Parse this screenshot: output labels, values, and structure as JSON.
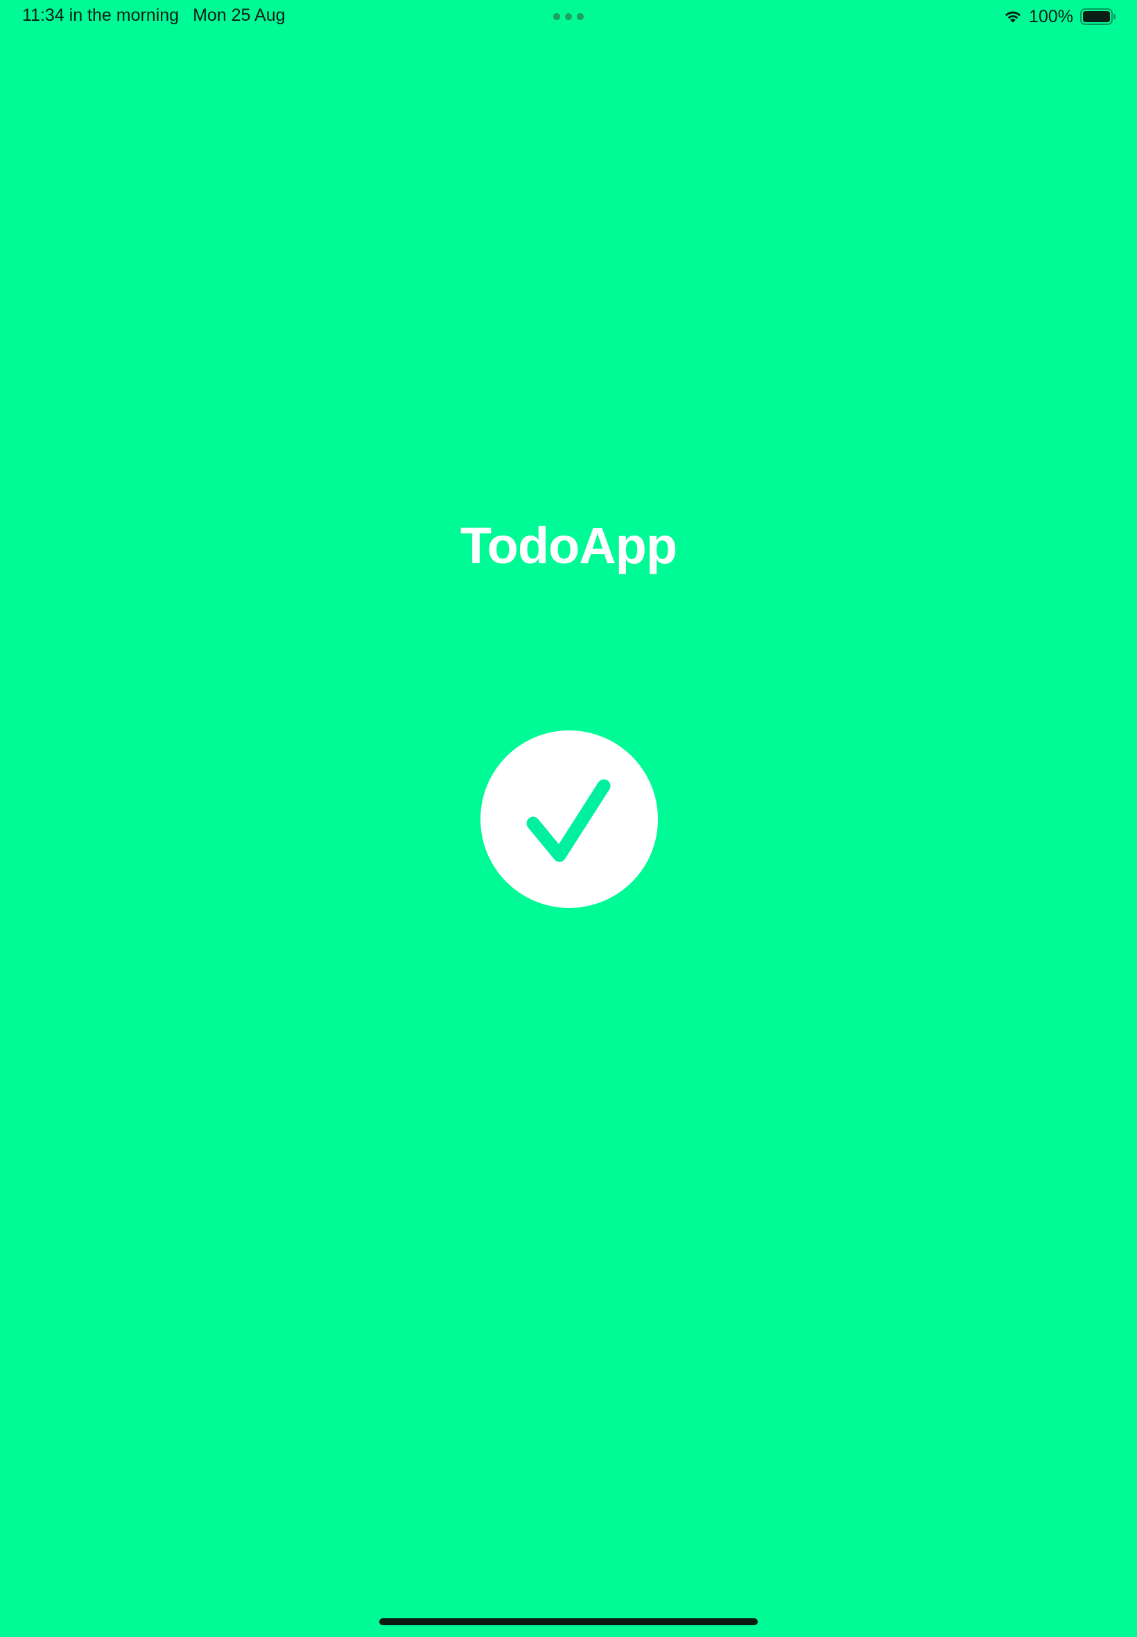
{
  "status_bar": {
    "time": "11:34 in the morning",
    "date": "Mon 25 Aug",
    "battery_percent": "100%",
    "battery_level": 1.0
  },
  "splash": {
    "app_title": "TodoApp",
    "logo_icon": "checkmark-circle-icon"
  },
  "colors": {
    "background": "#00FA96",
    "logo_circle": "#FFFFFF",
    "checkmark": "#00F0A0",
    "title_text": "#FFFFFF"
  }
}
